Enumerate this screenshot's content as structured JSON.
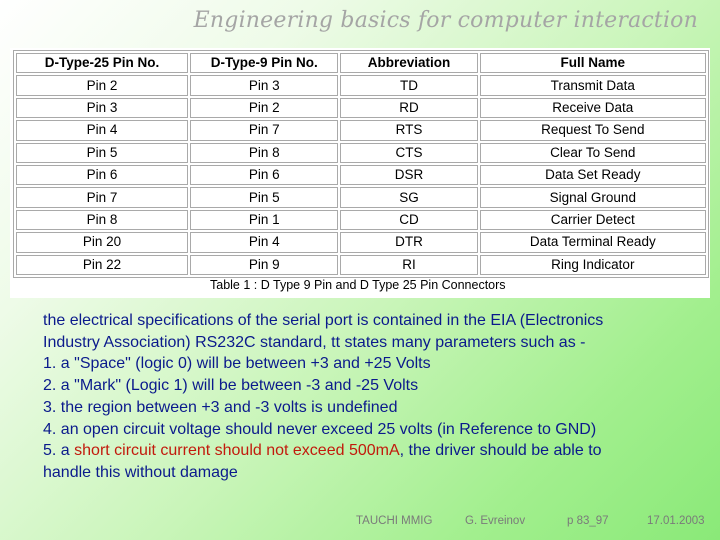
{
  "slide": {
    "title": "Engineering basics for computer interaction"
  },
  "table": {
    "headers": [
      "D-Type-25 Pin No.",
      "D-Type-9 Pin No.",
      "Abbreviation",
      "Full Name"
    ],
    "rows": [
      [
        "Pin 2",
        "Pin 3",
        "TD",
        "Transmit Data"
      ],
      [
        "Pin 3",
        "Pin 2",
        "RD",
        "Receive Data"
      ],
      [
        "Pin 4",
        "Pin 7",
        "RTS",
        "Request To Send"
      ],
      [
        "Pin 5",
        "Pin 8",
        "CTS",
        "Clear To Send"
      ],
      [
        "Pin 6",
        "Pin 6",
        "DSR",
        "Data Set Ready"
      ],
      [
        "Pin 7",
        "Pin 5",
        "SG",
        "Signal Ground"
      ],
      [
        "Pin 8",
        "Pin 1",
        "CD",
        "Carrier Detect"
      ],
      [
        "Pin 20",
        "Pin 4",
        "DTR",
        "Data Terminal Ready"
      ],
      [
        "Pin 22",
        "Pin 9",
        "RI",
        "Ring Indicator"
      ]
    ],
    "caption": "Table 1 : D Type 9 Pin and D Type 25 Pin Connectors"
  },
  "body": {
    "intro_line1": "the electrical specifications of the serial port is contained in the EIA (Electronics",
    "intro_line2": "Industry Association) RS232C standard, tt states many parameters such as -",
    "item1": "1. a \"Space\" (logic 0) will be between +3 and +25 Volts",
    "item2": "2. a \"Mark\" (Logic 1) will be between -3 and -25 Volts",
    "item3": "3. the region between +3 and -3 volts is undefined",
    "item4": "4. an open circuit voltage should never exceed 25 volts (in Reference to GND)",
    "item5_prefix": "5. a ",
    "item5_highlight": "short circuit current should not exceed 500mA",
    "item5_suffix": ", the driver should be able to",
    "item5_line2": "handle this without damage",
    "highlight_color": "#c21a0c"
  },
  "footer": {
    "org": "TAUCHI MMIG",
    "author": "G. Evreinov",
    "page": "p 83_97",
    "date": "17.01.2003"
  }
}
